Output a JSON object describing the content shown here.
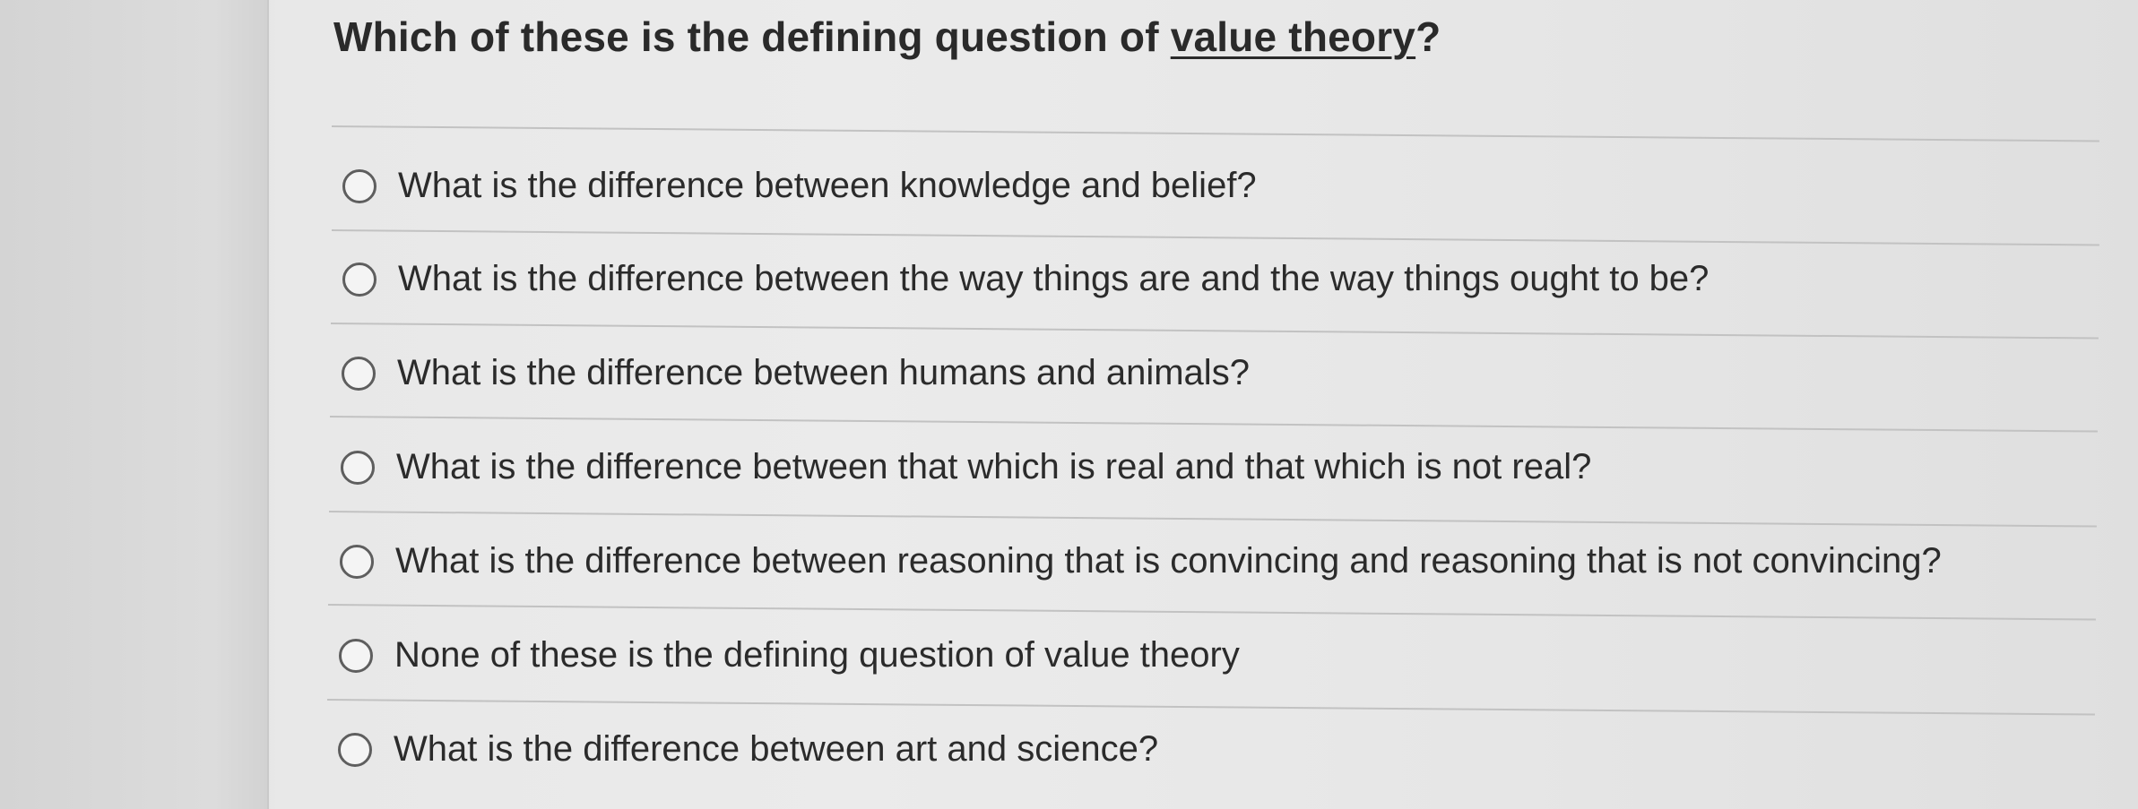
{
  "question": {
    "prefix": "Which of these is the defining question of ",
    "term": "value theory",
    "suffix": "?"
  },
  "options": [
    {
      "label": "What is the difference between knowledge and belief?",
      "selected": false
    },
    {
      "label": "What is the difference between the way things are and the way things ought to be?",
      "selected": false
    },
    {
      "label": "What is the difference between humans and animals?",
      "selected": false
    },
    {
      "label": "What is the difference between that which is real and that which is not real?",
      "selected": false
    },
    {
      "label": "What is the difference between reasoning that is convincing and reasoning that is not convincing?",
      "selected": false
    },
    {
      "label": "None of these is the defining question of value theory",
      "selected": false
    },
    {
      "label": "What is the difference between art and science?",
      "selected": false
    }
  ]
}
